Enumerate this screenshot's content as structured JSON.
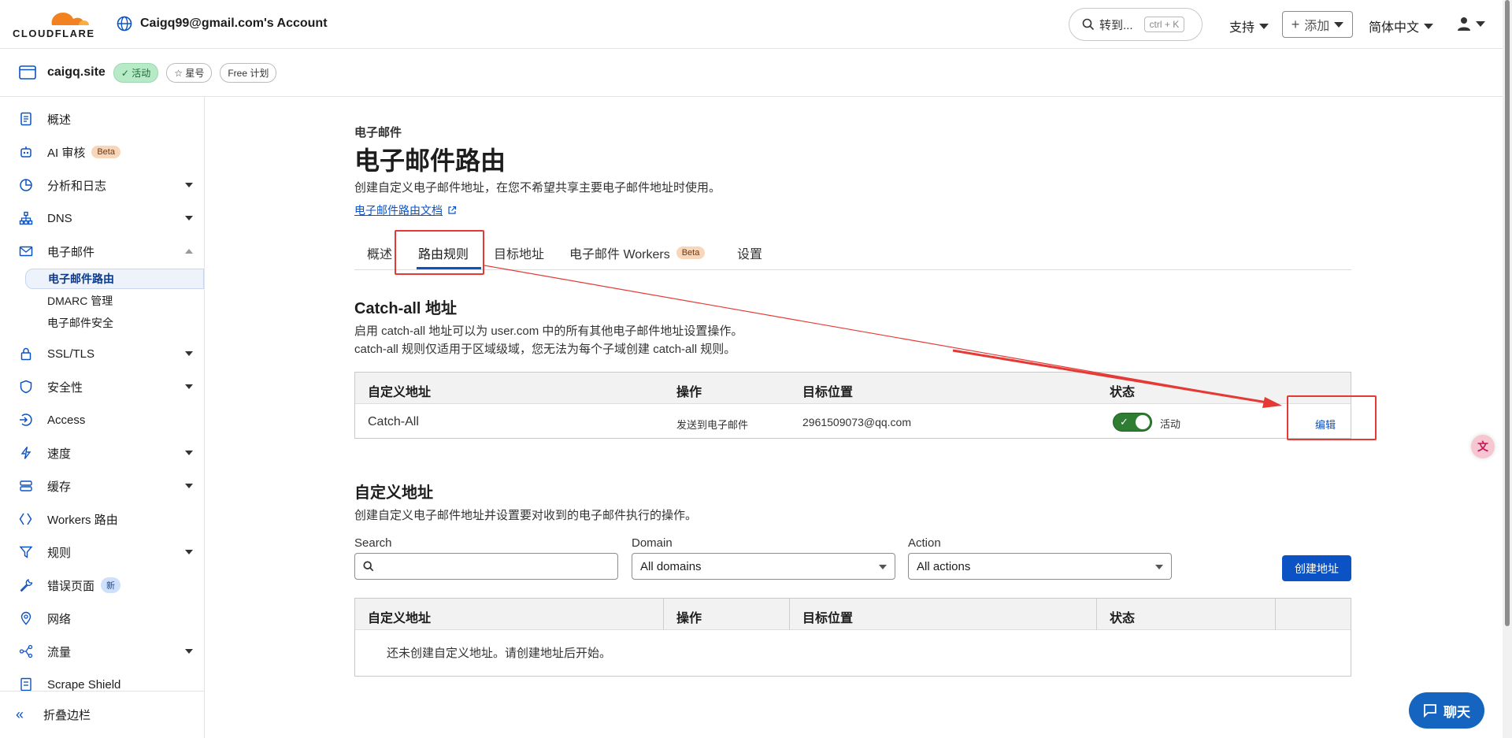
{
  "header": {
    "logo_text": "CLOUDFLARE",
    "account_label": "Caigq99@gmail.com's Account",
    "search_label": "转到...",
    "search_shortcut": "ctrl + K",
    "support_label": "支持",
    "add_label": "添加",
    "language_label": "简体中文"
  },
  "zone": {
    "name": "caigq.site",
    "status_label": "活动",
    "star_label": "星号",
    "plan_label": "Free 计划"
  },
  "sidebar": {
    "items": [
      {
        "label": "概述",
        "icon": "document-icon"
      },
      {
        "label": "AI 审核",
        "icon": "robot-icon",
        "pill": "Beta"
      },
      {
        "label": "分析和日志",
        "icon": "chart-pie-icon"
      },
      {
        "label": "DNS",
        "icon": "network-tree-icon"
      },
      {
        "label": "电子邮件",
        "icon": "envelope-icon"
      },
      {
        "label": "SSL/TLS",
        "icon": "lock-icon"
      },
      {
        "label": "安全性",
        "icon": "shield-icon"
      },
      {
        "label": "Access",
        "icon": "access-icon"
      },
      {
        "label": "速度",
        "icon": "lightning-icon"
      },
      {
        "label": "缓存",
        "icon": "database-icon"
      },
      {
        "label": "Workers 路由",
        "icon": "workers-icon"
      },
      {
        "label": "规则",
        "icon": "funnel-icon"
      },
      {
        "label": "错误页面",
        "icon": "wrench-icon",
        "pill": "新"
      },
      {
        "label": "网络",
        "icon": "location-pin-icon"
      },
      {
        "label": "流量",
        "icon": "traffic-icon"
      },
      {
        "label": "Scrape Shield",
        "icon": "scrape-shield-icon"
      }
    ],
    "email_sub": [
      "电子邮件路由",
      "DMARC 管理",
      "电子邮件安全"
    ],
    "collapse_label": "折叠边栏"
  },
  "page": {
    "breadcrumb": "电子邮件",
    "title": "电子邮件路由",
    "description": "创建自定义电子邮件地址，在您不希望共享主要电子邮件地址时使用。",
    "doc_link": "电子邮件路由文档",
    "tabs": [
      "概述",
      "路由规则",
      "目标地址",
      "电子邮件 Workers",
      "设置"
    ],
    "tab_beta": "Beta"
  },
  "catch_all": {
    "title": "Catch-all 地址",
    "text_line1": "启用 catch-all 地址可以为 user.com 中的所有其他电子邮件地址设置操作。",
    "text_line2": "catch-all 规则仅适用于区域级域，您无法为每个子域创建 catch-all 规则。",
    "columns": [
      "自定义地址",
      "操作",
      "目标位置",
      "状态"
    ],
    "row": {
      "address": "Catch-All",
      "action": "发送到电子邮件",
      "destination": "2961509073@qq.com",
      "status": "活动",
      "enabled": true,
      "edit_label": "编辑"
    }
  },
  "custom": {
    "title": "自定义地址",
    "description": "创建自定义电子邮件地址并设置要对收到的电子邮件执行的操作。",
    "search_label": "Search",
    "search_value": "",
    "domain_label": "Domain",
    "domain_value": "All domains",
    "action_label": "Action",
    "action_value": "All actions",
    "create_label": "创建地址",
    "columns": [
      "自定义地址",
      "操作",
      "目标位置",
      "状态"
    ],
    "empty_text": "还未创建自定义地址。请创建地址后开始。"
  },
  "widgets": {
    "chat_label": "聊天",
    "translate_glyph": "文"
  },
  "colors": {
    "brand_orange": "#f48120",
    "link_blue": "#0b53c4",
    "toggle_green": "#2e7d32",
    "annotation_red": "#e53935"
  }
}
